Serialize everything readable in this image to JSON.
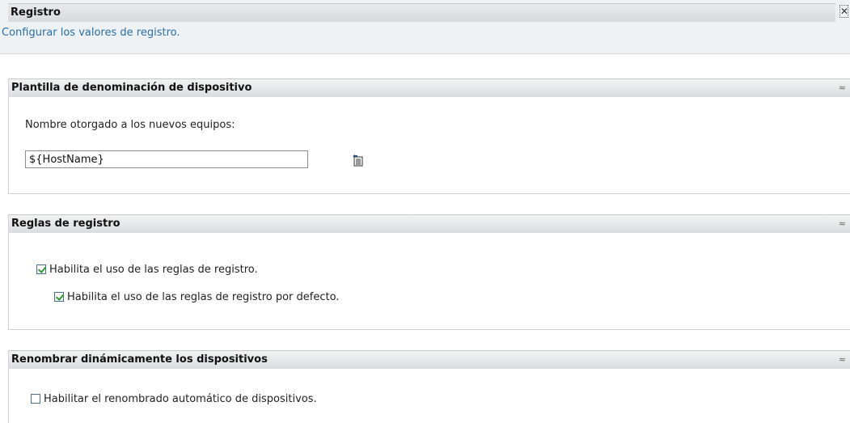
{
  "header": {
    "title": "Registro",
    "subtitle": "Configurar los valores de registro.",
    "close_glyph": "✕"
  },
  "naming": {
    "title": "Plantilla de denominación de dispositivo",
    "label": "Nombre otorgado a los nuevos equipos:",
    "value": "${HostName}",
    "collapse_glyph": "≈"
  },
  "rules": {
    "title": "Reglas de registro",
    "enable_rules": {
      "label": "Habilita el uso de las reglas de registro.",
      "checked": true
    },
    "enable_default": {
      "label": "Habilita el uso de las reglas de registro por defecto.",
      "checked": true
    },
    "collapse_glyph": "≈"
  },
  "rename": {
    "title": "Renombrar dinámicamente los dispositivos",
    "enable_rename": {
      "label": "Habilitar el renombrado automático de dispositivos.",
      "checked": false
    },
    "collapse_glyph": "≈"
  },
  "icons": {
    "close": "close-icon",
    "collapse": "collapse-icon",
    "insert_variable": "insert-variable-icon"
  }
}
